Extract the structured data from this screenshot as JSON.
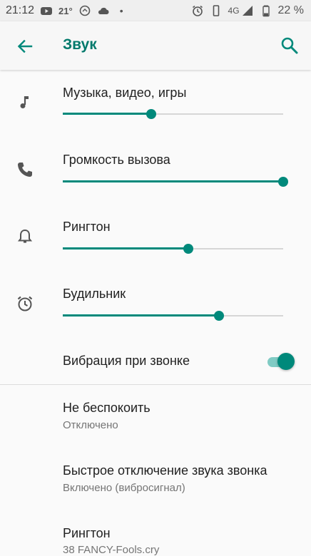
{
  "status_bar": {
    "time": "21:12",
    "temperature": "21°",
    "network": "4G",
    "battery": "22 %",
    "dot": "•"
  },
  "toolbar": {
    "title": "Звук"
  },
  "volume": {
    "media": {
      "label": "Музыка, видео, игры",
      "level": 0.4
    },
    "call": {
      "label": "Громкость вызова",
      "level": 1.0
    },
    "ringtone": {
      "label": "Рингтон",
      "level": 0.57
    },
    "alarm": {
      "label": "Будильник",
      "level": 0.71
    }
  },
  "vibrate": {
    "label": "Вибрация при звонке",
    "enabled": true
  },
  "settings": [
    {
      "title": "Не беспокоить",
      "summary": "Отключено"
    },
    {
      "title": "Быстрое отключение звука звонка",
      "summary": "Включено (вибросигнал)"
    },
    {
      "title": "Рингтон",
      "summary": "38 FANCY-Fools.cry"
    }
  ],
  "colors": {
    "accent": "#00897b",
    "title": "#00796b",
    "track": "#d6d6d6"
  }
}
